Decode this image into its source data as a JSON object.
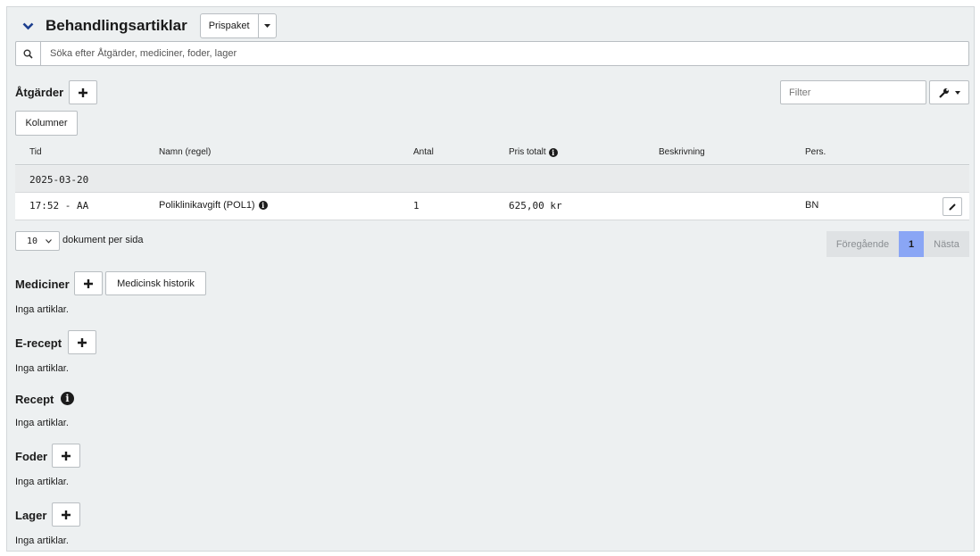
{
  "header": {
    "title": "Behandlingsartiklar",
    "price_package_label": "Prispaket"
  },
  "search": {
    "placeholder": "Söka efter Åtgärder, mediciner, foder, lager"
  },
  "atgarder": {
    "label": "Åtgärder",
    "filter_placeholder": "Filter",
    "columns_button": "Kolumner",
    "columns": [
      "Tid",
      "Namn (regel)",
      "Antal",
      "Pris totalt",
      "Beskrivning",
      "Pers."
    ],
    "date_group": "2025-03-20",
    "rows": [
      {
        "tid": "17:52 - AA",
        "namn": "Poliklinikavgift (POL1)",
        "antal": "1",
        "pris": "625,00 kr",
        "beskrivning": "",
        "pers": "BN"
      }
    ],
    "per_page_value": "10",
    "per_page_label": "dokument per sida",
    "pager": {
      "prev": "Föregående",
      "current": "1",
      "next": "Nästa"
    }
  },
  "sections": {
    "mediciner": {
      "label": "Mediciner",
      "history_button": "Medicinsk historik",
      "empty": "Inga artiklar."
    },
    "erecept": {
      "label": "E-recept",
      "empty": "Inga artiklar."
    },
    "recept": {
      "label": "Recept",
      "empty": "Inga artiklar."
    },
    "foder": {
      "label": "Foder",
      "empty": "Inga artiklar."
    },
    "lager": {
      "label": "Lager",
      "empty": "Inga artiklar."
    }
  },
  "colors": {
    "accent": "#1d3f8f",
    "pager_active": "#8aa6f5",
    "pager_disabled": "#dfe2e4",
    "panel_bg": "#edf0f1"
  },
  "icons": [
    "chevron-down-icon",
    "caret-down-icon",
    "search-icon",
    "plus-icon",
    "wrench-icon",
    "info-icon",
    "pencil-icon"
  ]
}
